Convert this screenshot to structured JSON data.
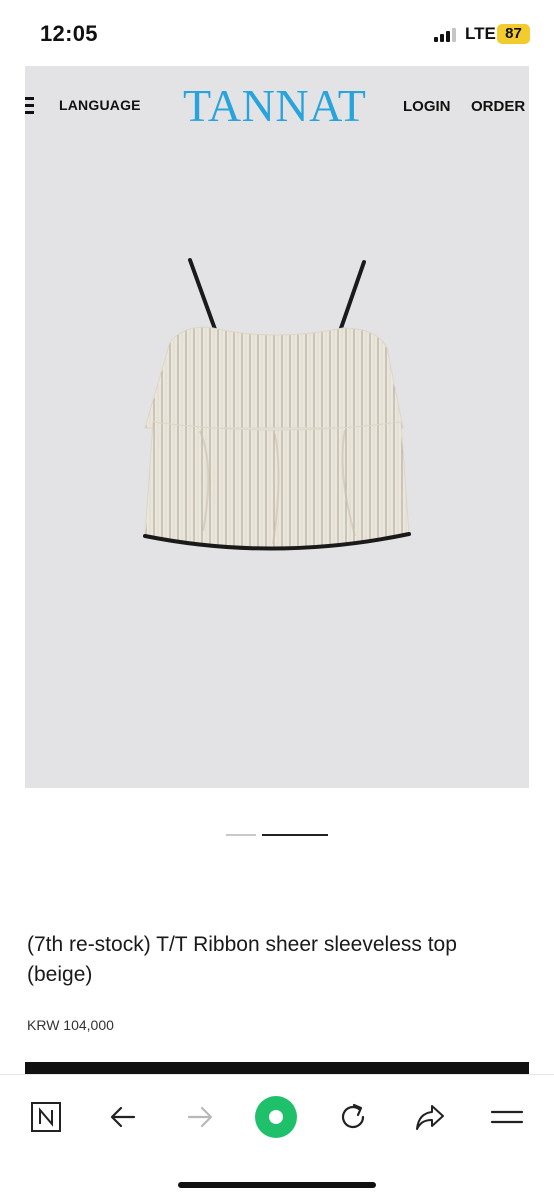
{
  "status_bar": {
    "time": "12:05",
    "network": "LTE",
    "battery": "87"
  },
  "site": {
    "logo": "TANNAT",
    "logo_color": "#27a4dd",
    "nav": {
      "language": "LANGUAGE",
      "login": "LOGIN",
      "order": "ORDER"
    }
  },
  "product": {
    "title": "(7th re-stock) T/T Ribbon sheer sleeveless top (beige)",
    "price": "KRW 104,000",
    "image_alt": "beige striped sleeveless top with black ribbon straps",
    "carousel": {
      "slides": 2,
      "active": 2
    }
  },
  "browser_toolbar": {
    "icons": [
      "naver-n-icon",
      "back-arrow-icon",
      "forward-arrow-icon",
      "green-home-icon",
      "refresh-icon",
      "share-icon",
      "menu-icon"
    ],
    "accent": "#1ec16a"
  }
}
